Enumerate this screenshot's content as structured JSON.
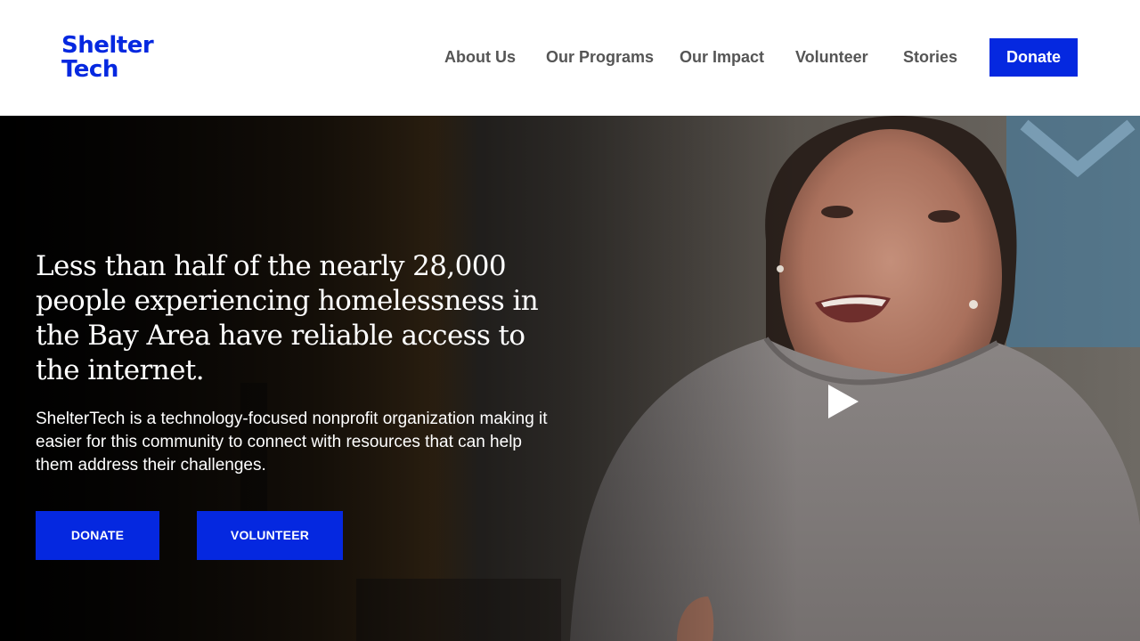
{
  "brand": {
    "logo_line1": "Shelter",
    "logo_line2": "Tech",
    "accent_color": "#0528e0"
  },
  "nav": {
    "items": [
      {
        "label": "About Us"
      },
      {
        "label": "Our Programs"
      },
      {
        "label": "Our Impact"
      },
      {
        "label": "Volunteer"
      },
      {
        "label": "Stories"
      }
    ],
    "donate_label": "Donate"
  },
  "hero": {
    "headline": "Less than half of the nearly 28,000 people experiencing homelessness in the Bay Area have reliable access to the internet.",
    "subtext": "ShelterTech is a technology-focused nonprofit organization making it easier for this community to connect with resources that can help them address their challenges.",
    "donate_button": "DONATE",
    "volunteer_button": "VOLUNTEER",
    "video_icon": "play-icon"
  }
}
